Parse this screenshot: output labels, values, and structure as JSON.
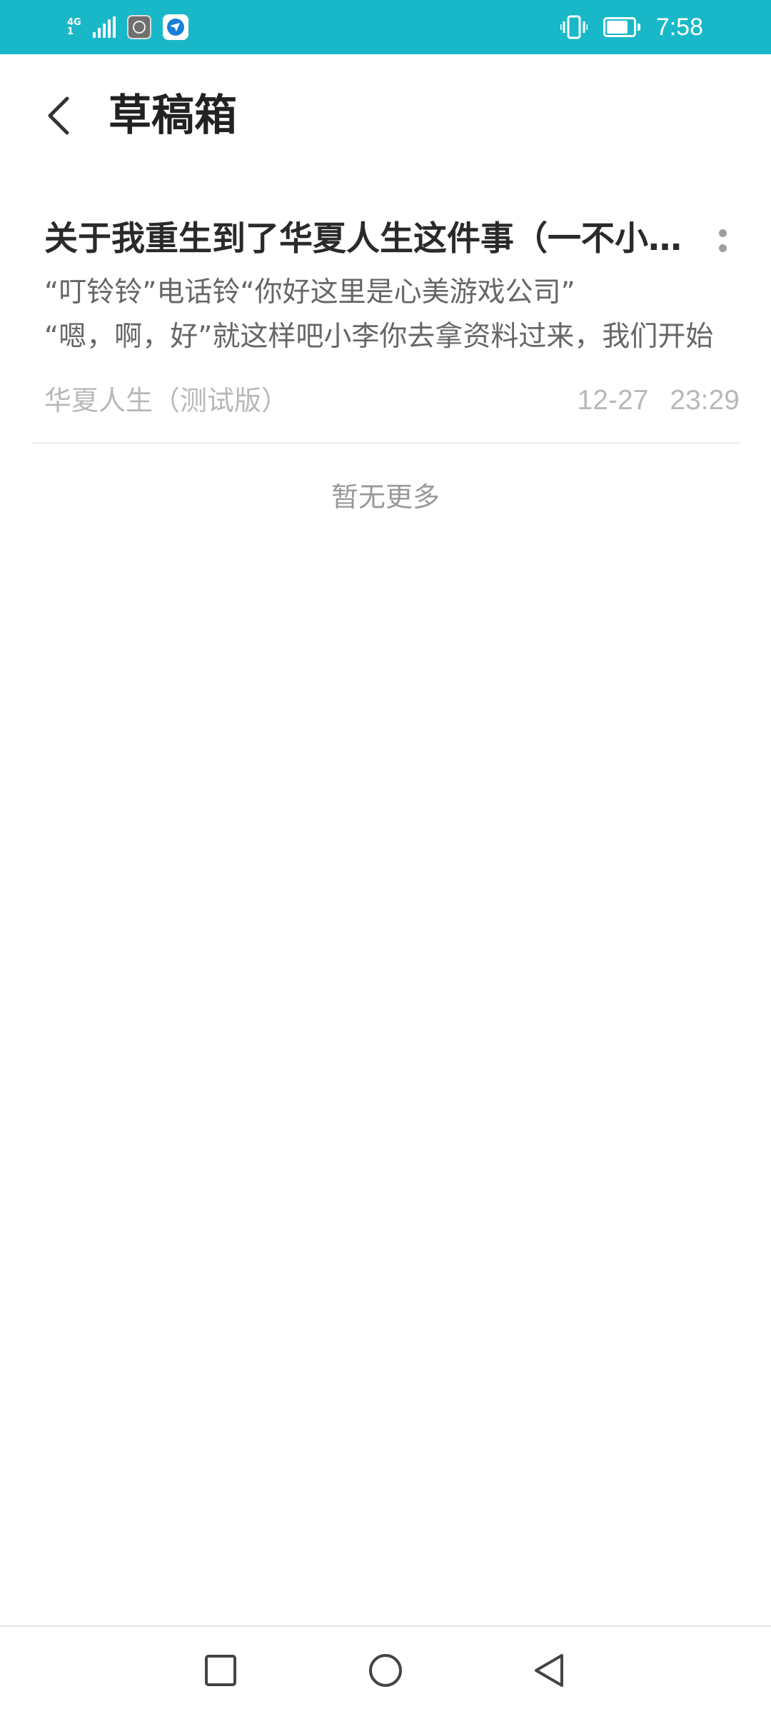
{
  "status_bar": {
    "network_type_top": "4G",
    "network_type_bottom": "1",
    "time": "7:58",
    "battery_percent": 80,
    "icons": [
      "signal-icon",
      "app-notification-icon",
      "browser-notification-icon",
      "vibrate-icon",
      "battery-icon"
    ]
  },
  "header": {
    "back_icon": "chevron-left-icon",
    "title": "草稿箱"
  },
  "drafts": [
    {
      "title": "关于我重生到了华夏人生这件事（一不小心就出名了）",
      "excerpt_line_1": "“叮铃铃”电话铃“你好这里是心美游戏公司”",
      "excerpt_line_2": "“嗯，啊，好”就这样吧小李你去拿资料过来，我们开始",
      "source": "华夏人生（测试版）",
      "date": "12-27",
      "time": "23:29"
    }
  ],
  "list_footer": "暂无更多",
  "nav_bar": {
    "icons": [
      "recent-apps-icon",
      "home-icon",
      "back-triangle-icon"
    ]
  },
  "colors": {
    "status_bar_bg": "#19b8c9",
    "title_text": "#222222",
    "meta_text": "#b8b8b8"
  }
}
